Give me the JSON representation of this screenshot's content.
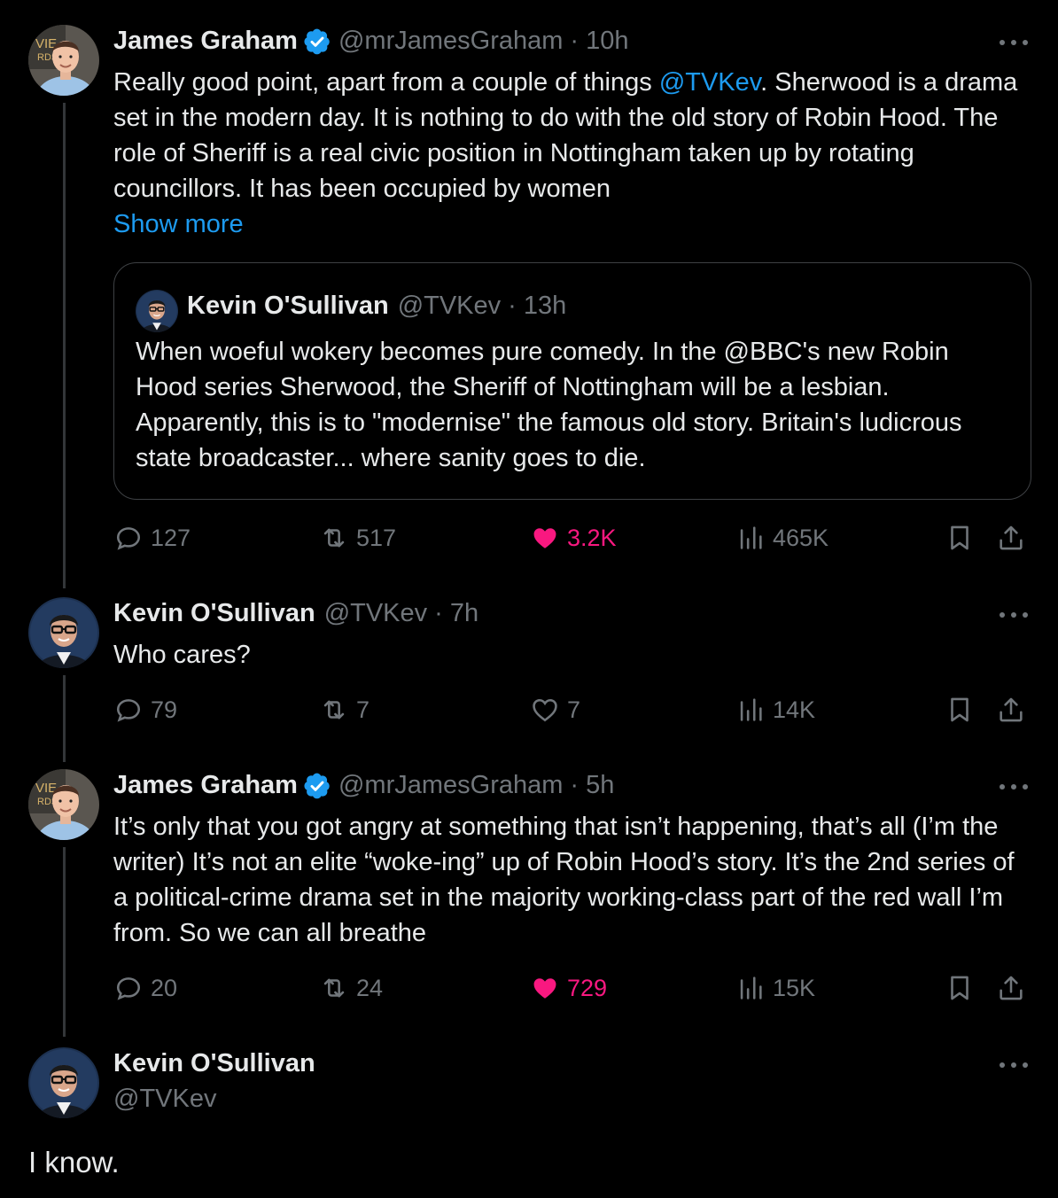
{
  "colors": {
    "background": "#000000",
    "text": "#e7e9ea",
    "muted": "#71767b",
    "link": "#1d9bf0",
    "like": "#f91880",
    "verified": "#1d9bf0"
  },
  "tweets": [
    {
      "name": "James Graham",
      "verified": true,
      "handle": "@mrJamesGraham",
      "dot": "·",
      "time": "10h",
      "text_before": "Really good point, apart from a couple of things ",
      "mention": "@TVKev",
      "text_after": ". Sherwood is a drama set in the modern day. It is nothing to do with the old story of Robin Hood. The role of Sheriff is a real civic position in Nottingham taken up by rotating councillors. It has been occupied by women",
      "show_more": "Show more",
      "quote": {
        "name": "Kevin O'Sullivan",
        "handle": "@TVKev",
        "dot": "·",
        "time": "13h",
        "text": "When woeful wokery becomes pure comedy.  In the @BBC's new Robin Hood series Sherwood, the Sheriff of Nottingham will be a lesbian. Apparently, this is to \"modernise\" the famous old story. Britain's ludicrous state broadcaster... where sanity goes to die."
      },
      "replies": "127",
      "retweets": "517",
      "likes": "3.2K",
      "liked": true,
      "views": "465K"
    },
    {
      "name": "Kevin O'Sullivan",
      "handle": "@TVKev",
      "dot": "·",
      "time": "7h",
      "text": "Who cares?",
      "replies": "79",
      "retweets": "7",
      "likes": "7",
      "liked": false,
      "views": "14K"
    },
    {
      "name": "James Graham",
      "verified": true,
      "handle": "@mrJamesGraham",
      "dot": "·",
      "time": "5h",
      "text": "It’s only that you got angry at something that isn’t happening, that’s all (I’m the writer) It’s not an elite “woke-ing” up of Robin Hood’s story. It’s the 2nd series of a political-crime drama set in the majority working-class part of the red wall I’m from. So we can all breathe",
      "replies": "20",
      "retweets": "24",
      "likes": "729",
      "liked": true,
      "views": "15K"
    },
    {
      "name": "Kevin O'Sullivan",
      "handle": "@TVKev",
      "text": "I know."
    }
  ],
  "icons": [
    "reply-icon",
    "retweet-icon",
    "heart-icon",
    "views-icon",
    "bookmark-icon",
    "share-icon",
    "more-icon",
    "verified-icon"
  ]
}
